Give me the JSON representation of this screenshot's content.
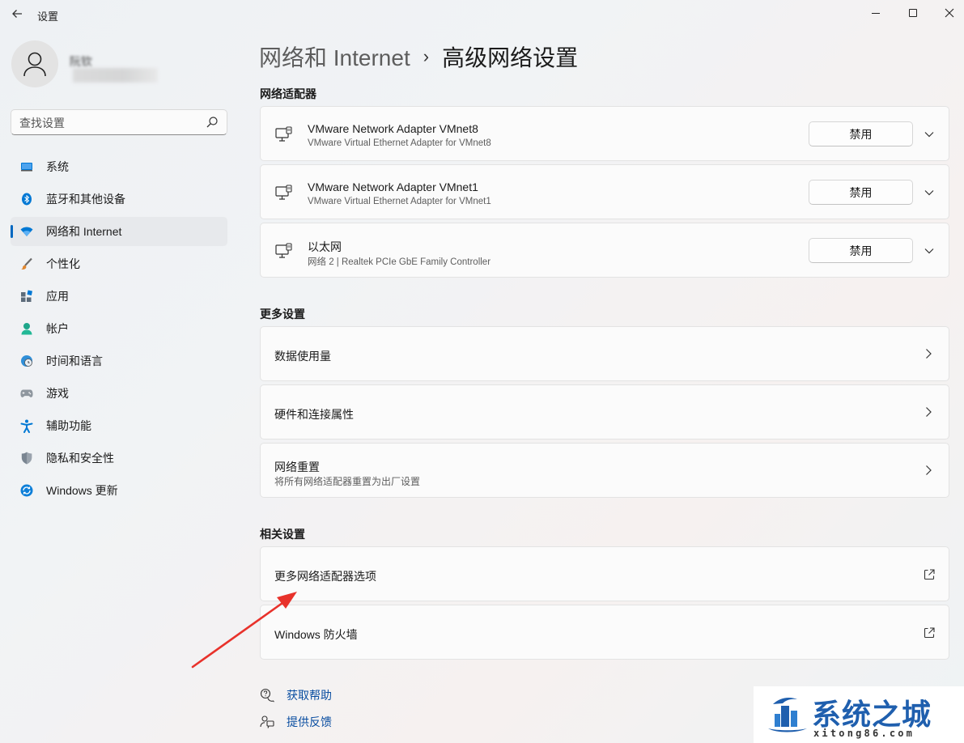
{
  "window": {
    "title": "设置",
    "back_icon": "back-arrow-icon",
    "controls": [
      "minimize-icon",
      "maximize-icon",
      "close-icon"
    ]
  },
  "user": {
    "name": "阮钦",
    "avatar_icon": "user-avatar-icon"
  },
  "search": {
    "placeholder": "查找设置",
    "icon": "search-icon"
  },
  "sidebar": {
    "items": [
      {
        "label": "系统",
        "icon": "system-monitor-icon",
        "active": false
      },
      {
        "label": "蓝牙和其他设备",
        "icon": "bluetooth-icon",
        "active": false
      },
      {
        "label": "网络和 Internet",
        "icon": "wifi-icon",
        "active": true
      },
      {
        "label": "个性化",
        "icon": "paintbrush-icon",
        "active": false
      },
      {
        "label": "应用",
        "icon": "apps-icon",
        "active": false
      },
      {
        "label": "帐户",
        "icon": "account-icon",
        "active": false
      },
      {
        "label": "时间和语言",
        "icon": "globe-clock-icon",
        "active": false
      },
      {
        "label": "游戏",
        "icon": "gamepad-icon",
        "active": false
      },
      {
        "label": "辅助功能",
        "icon": "accessibility-icon",
        "active": false
      },
      {
        "label": "隐私和安全性",
        "icon": "shield-icon",
        "active": false
      },
      {
        "label": "Windows 更新",
        "icon": "update-icon",
        "active": false
      }
    ],
    "accent_color": "#0067c0"
  },
  "breadcrumb": {
    "parent": "网络和 Internet",
    "separator": "›",
    "current": "高级网络设置"
  },
  "adapters": {
    "section_title": "网络适配器",
    "items": [
      {
        "name": "VMware Network Adapter VMnet8",
        "description": "VMware Virtual Ethernet Adapter for VMnet8",
        "button": "禁用"
      },
      {
        "name": "VMware Network Adapter VMnet1",
        "description": "VMware Virtual Ethernet Adapter for VMnet1",
        "button": "禁用"
      },
      {
        "name": "以太网",
        "description": "网络 2 | Realtek PCIe GbE Family Controller",
        "button": "禁用"
      }
    ]
  },
  "more_settings": {
    "section_title": "更多设置",
    "items": [
      {
        "label": "数据使用量",
        "sub": ""
      },
      {
        "label": "硬件和连接属性",
        "sub": ""
      },
      {
        "label": "网络重置",
        "sub": "将所有网络适配器重置为出厂设置"
      }
    ]
  },
  "related_settings": {
    "section_title": "相关设置",
    "items": [
      {
        "label": "更多网络适配器选项",
        "icon": "external-link-icon"
      },
      {
        "label": "Windows 防火墙",
        "icon": "external-link-icon"
      }
    ]
  },
  "help": {
    "get_help": "获取帮助",
    "feedback": "提供反馈",
    "link_color": "#0a4ea1"
  },
  "watermark": {
    "title": "系统之城",
    "url": "xitong86.com"
  },
  "annotation": {
    "arrow_color": "#e8322b"
  }
}
